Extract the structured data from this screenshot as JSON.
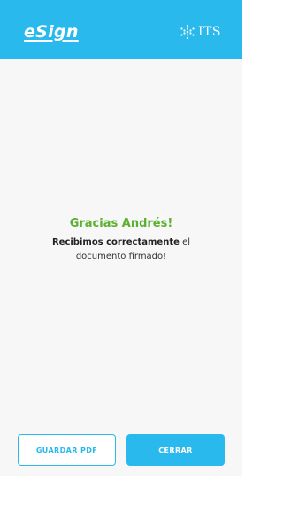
{
  "header": {
    "logo_text": "eSign",
    "brand_text": "ITS",
    "color": "#29b9ec"
  },
  "message": {
    "thanks": "Gracias Andrés!",
    "line_bold": "Recibimos correctamente",
    "line_rest": " el documento firmado!",
    "accent_color": "#5bb12f"
  },
  "actions": {
    "save_pdf_label": "GUARDAR PDF",
    "close_label": "CERRAR"
  }
}
